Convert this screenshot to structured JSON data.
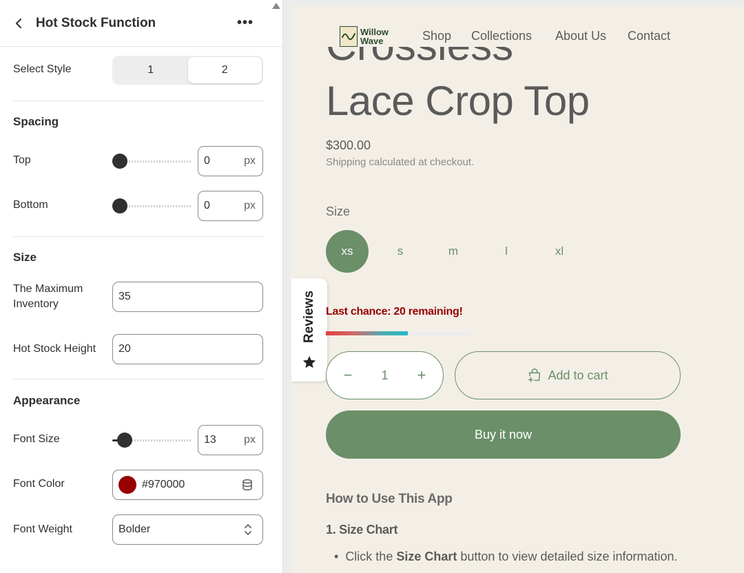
{
  "panel": {
    "title": "Hot Stock Function",
    "select_style": {
      "label": "Select Style",
      "options": [
        "1",
        "2"
      ],
      "selected": "2"
    },
    "spacing": {
      "title": "Spacing",
      "top": {
        "label": "Top",
        "value": "0",
        "unit": "px",
        "slider_fraction": 0
      },
      "bottom": {
        "label": "Bottom",
        "value": "0",
        "unit": "px",
        "slider_fraction": 0
      }
    },
    "size": {
      "title": "Size",
      "max_inventory": {
        "label": "The Maximum Inventory",
        "value": "35"
      },
      "height": {
        "label": "Hot Stock Height",
        "value": "20"
      }
    },
    "appearance": {
      "title": "Appearance",
      "font_size": {
        "label": "Font Size",
        "value": "13",
        "unit": "px",
        "slider_fraction": 0.08
      },
      "font_color": {
        "label": "Font Color",
        "value": "#970000"
      },
      "font_weight": {
        "label": "Font Weight",
        "value": "Bolder"
      }
    }
  },
  "preview": {
    "logo": {
      "line1": "Willow",
      "line2": "Wave"
    },
    "nav": [
      "Shop",
      "Collections",
      "About Us",
      "Contact"
    ],
    "product": {
      "title_prev_line": "Crossless",
      "title": "Lace Crop Top",
      "price": "$300.00",
      "shipping": "Shipping calculated at checkout."
    },
    "size": {
      "label": "Size",
      "options": [
        "xs",
        "s",
        "m",
        "l",
        "xl"
      ],
      "selected": "xs"
    },
    "reviews_tab": "Reviews",
    "hot_stock": {
      "text": "Last chance: 20 remaining!",
      "color": "#970000",
      "fill_fraction": 0.57
    },
    "quantity": {
      "minus": "−",
      "value": "1",
      "plus": "+"
    },
    "add_to_cart": "Add to cart",
    "buy_now": "Buy it now",
    "how_to": {
      "title": "How to Use This App",
      "step1": "1. Size Chart",
      "bullet_pre": "Click the ",
      "bullet_bold": "Size Chart",
      "bullet_post": " button to view detailed size information."
    },
    "colors": {
      "accent": "#6a8f69",
      "background": "#f3efe7"
    }
  }
}
